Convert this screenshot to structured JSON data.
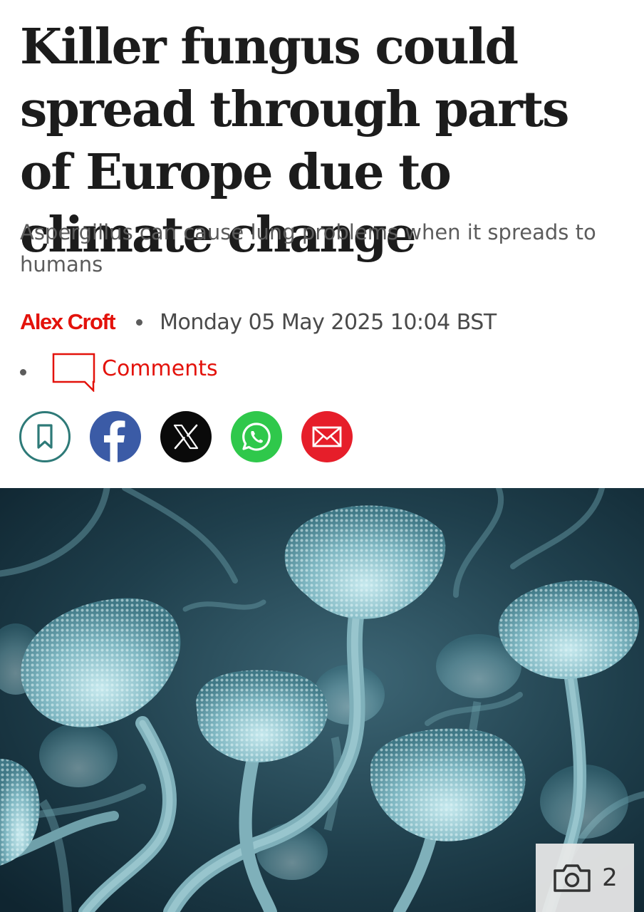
{
  "article": {
    "headline": "Killer fungus could spread through parts of Europe due to climate change",
    "subtitle": "Aspergillus can cause lung problems when it spreads to humans",
    "author": "Alex Croft",
    "date": "Monday 05 May 2025 10:04 BST",
    "comments_label": "Comments"
  },
  "share": {
    "buttons": [
      {
        "name": "bookmark",
        "icon": "bookmark-icon",
        "color": "#2e7a78"
      },
      {
        "name": "facebook",
        "icon": "facebook-icon",
        "color": "#3b5ba6"
      },
      {
        "name": "x",
        "icon": "x-icon",
        "color": "#0a0a0a"
      },
      {
        "name": "whatsapp",
        "icon": "whatsapp-icon",
        "color": "#2fc84b"
      },
      {
        "name": "email",
        "icon": "email-icon",
        "color": "#e61e2a"
      }
    ]
  },
  "gallery": {
    "count": "2",
    "icon": "camera-icon"
  },
  "colors": {
    "accent": "#e3120b",
    "text": "#1c1c1c",
    "muted": "#5c5c5c"
  }
}
